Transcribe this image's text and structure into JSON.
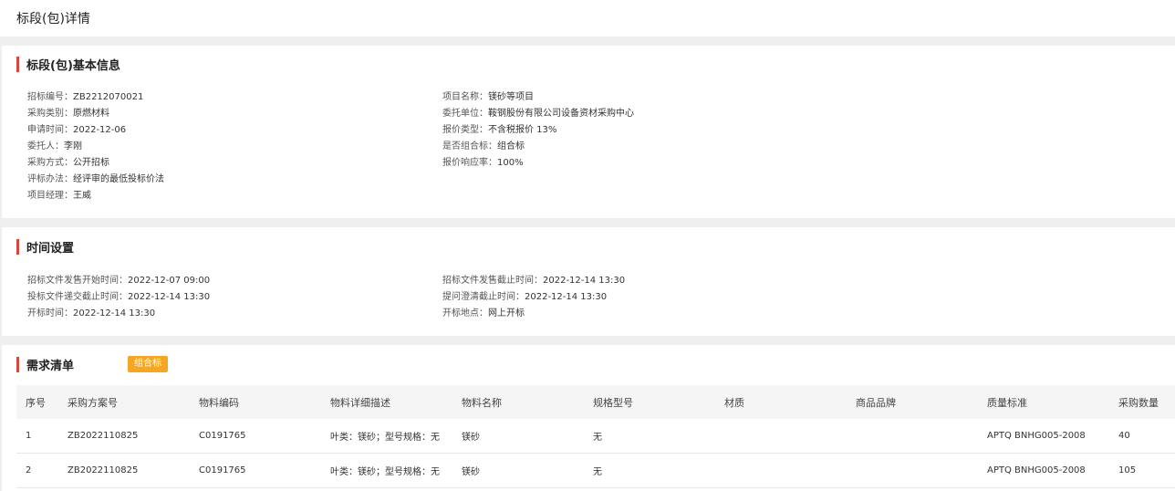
{
  "page_title": "标段(包)详情",
  "basic": {
    "title": "标段(包)基本信息",
    "left": [
      {
        "label": "招标编号：",
        "value": "ZB2212070021"
      },
      {
        "label": "采购类别：",
        "value": "原燃材料"
      },
      {
        "label": "申请时间：",
        "value": "2022-12-06"
      },
      {
        "label": "委托人：",
        "value": "李刚"
      },
      {
        "label": "采购方式：",
        "value": "公开招标"
      },
      {
        "label": "评标办法：",
        "value": "经评审的最低投标价法"
      },
      {
        "label": "项目经理：",
        "value": "王威"
      }
    ],
    "right": [
      {
        "label": "项目名称：",
        "value": "镁砂等项目"
      },
      {
        "label": "委托单位：",
        "value": "鞍钢股份有限公司设备资材采购中心"
      },
      {
        "label": "报价类型：",
        "value": "不含税报价 13%"
      },
      {
        "label": "是否组合标：",
        "value": "组合标"
      },
      {
        "label": "报价响应率：",
        "value": "100%"
      }
    ]
  },
  "time": {
    "title": "时间设置",
    "left": [
      {
        "label": "招标文件发售开始时间：",
        "value": "2022-12-07 09:00"
      },
      {
        "label": "投标文件递交截止时间：",
        "value": "2022-12-14 13:30"
      },
      {
        "label": "开标时间：",
        "value": "2022-12-14 13:30"
      }
    ],
    "right": [
      {
        "label": "招标文件发售截止时间：",
        "value": "2022-12-14 13:30"
      },
      {
        "label": "提问澄清截止时间：",
        "value": "2022-12-14 13:30"
      },
      {
        "label": "开标地点：",
        "value": "网上开标"
      }
    ]
  },
  "demand": {
    "title": "需求清单",
    "badge": "组合标",
    "columns": [
      "序号",
      "采购方案号",
      "物料编码",
      "物料详细描述",
      "物料名称",
      "规格型号",
      "材质",
      "商品品牌",
      "质量标准",
      "采购数量"
    ],
    "rows": [
      [
        "1",
        "ZB2022110825",
        "C0191765",
        "叶类：镁砂；型号规格：无",
        "镁砂",
        "无",
        "",
        "",
        "APTQ BNHG005-2008",
        "40"
      ],
      [
        "2",
        "ZB2022110825",
        "C0191765",
        "叶类：镁砂；型号规格：无",
        "镁砂",
        "无",
        "",
        "",
        "APTQ BNHG005-2008",
        "105"
      ]
    ]
  }
}
